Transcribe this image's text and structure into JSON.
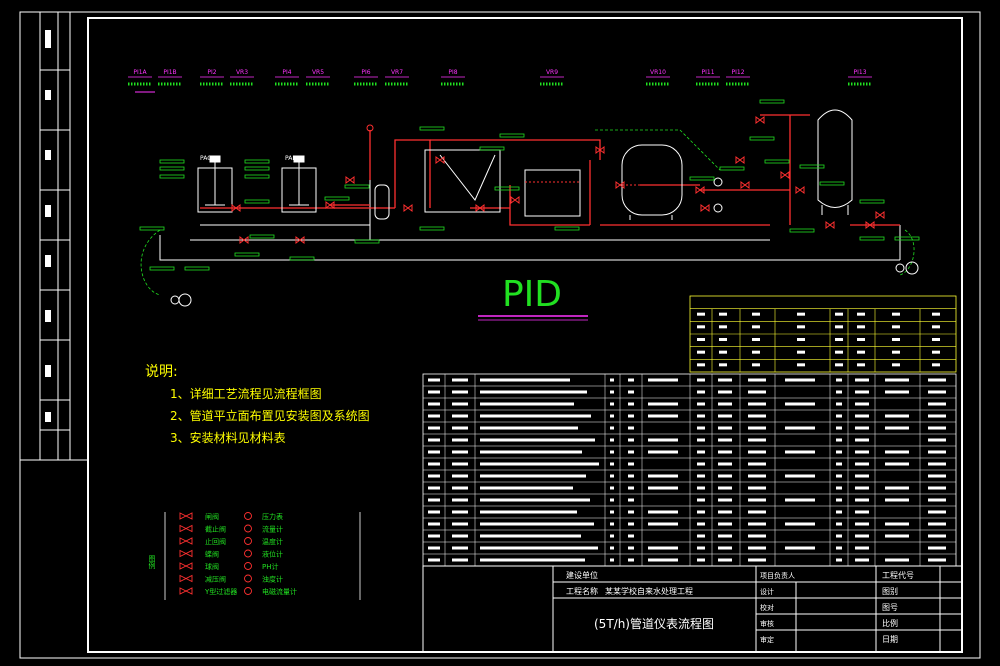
{
  "diagram": {
    "title_big": "PID",
    "notes_title": "说明:",
    "notes": [
      "1、详细工艺流程见流程框图",
      "2、管道平立面布置见安装图及系统图",
      "3、安装材料见材料表"
    ],
    "instrument_tags": [
      "PI1A",
      "PI1B",
      "PI2",
      "VR3",
      "PI4",
      "VR5",
      "PI6",
      "VR7",
      "PI8",
      "VR9",
      "VR10",
      "PI11",
      "PI12",
      "PI13"
    ],
    "equipment_labels": [
      "PAC",
      "PAM"
    ],
    "legend_title": "图例",
    "legend_left": [
      "闸阀",
      "截止阀",
      "止回阀",
      "蝶阀",
      "球阀",
      "减压阀",
      "Y型过滤器"
    ],
    "legend_right": [
      "压力表",
      "流量计",
      "温度计",
      "液位计",
      "PH计",
      "浊度计",
      "电磁流量计"
    ],
    "title_block": {
      "project_label": "建设单位",
      "project_name_label": "工程名称",
      "project_name": "某某学校自来水处理工程",
      "drawing_title": "(5T/h)管道仪表流程图",
      "right_header": "工程代号",
      "right_fields": [
        "图别",
        "图号",
        "比例",
        "日期"
      ],
      "sign_fields": [
        "项目负责人",
        "设计",
        "校对",
        "审核",
        "审定"
      ]
    }
  },
  "colors": {
    "background": "#000000",
    "frame": "#ffffff",
    "process": "#ffffff",
    "pipe_red": "#ff3030",
    "label_green": "#21e021",
    "tag_magenta": "#ff33ff",
    "table_yellow": "#ffff33",
    "notes_yellow": "#ffff00"
  }
}
